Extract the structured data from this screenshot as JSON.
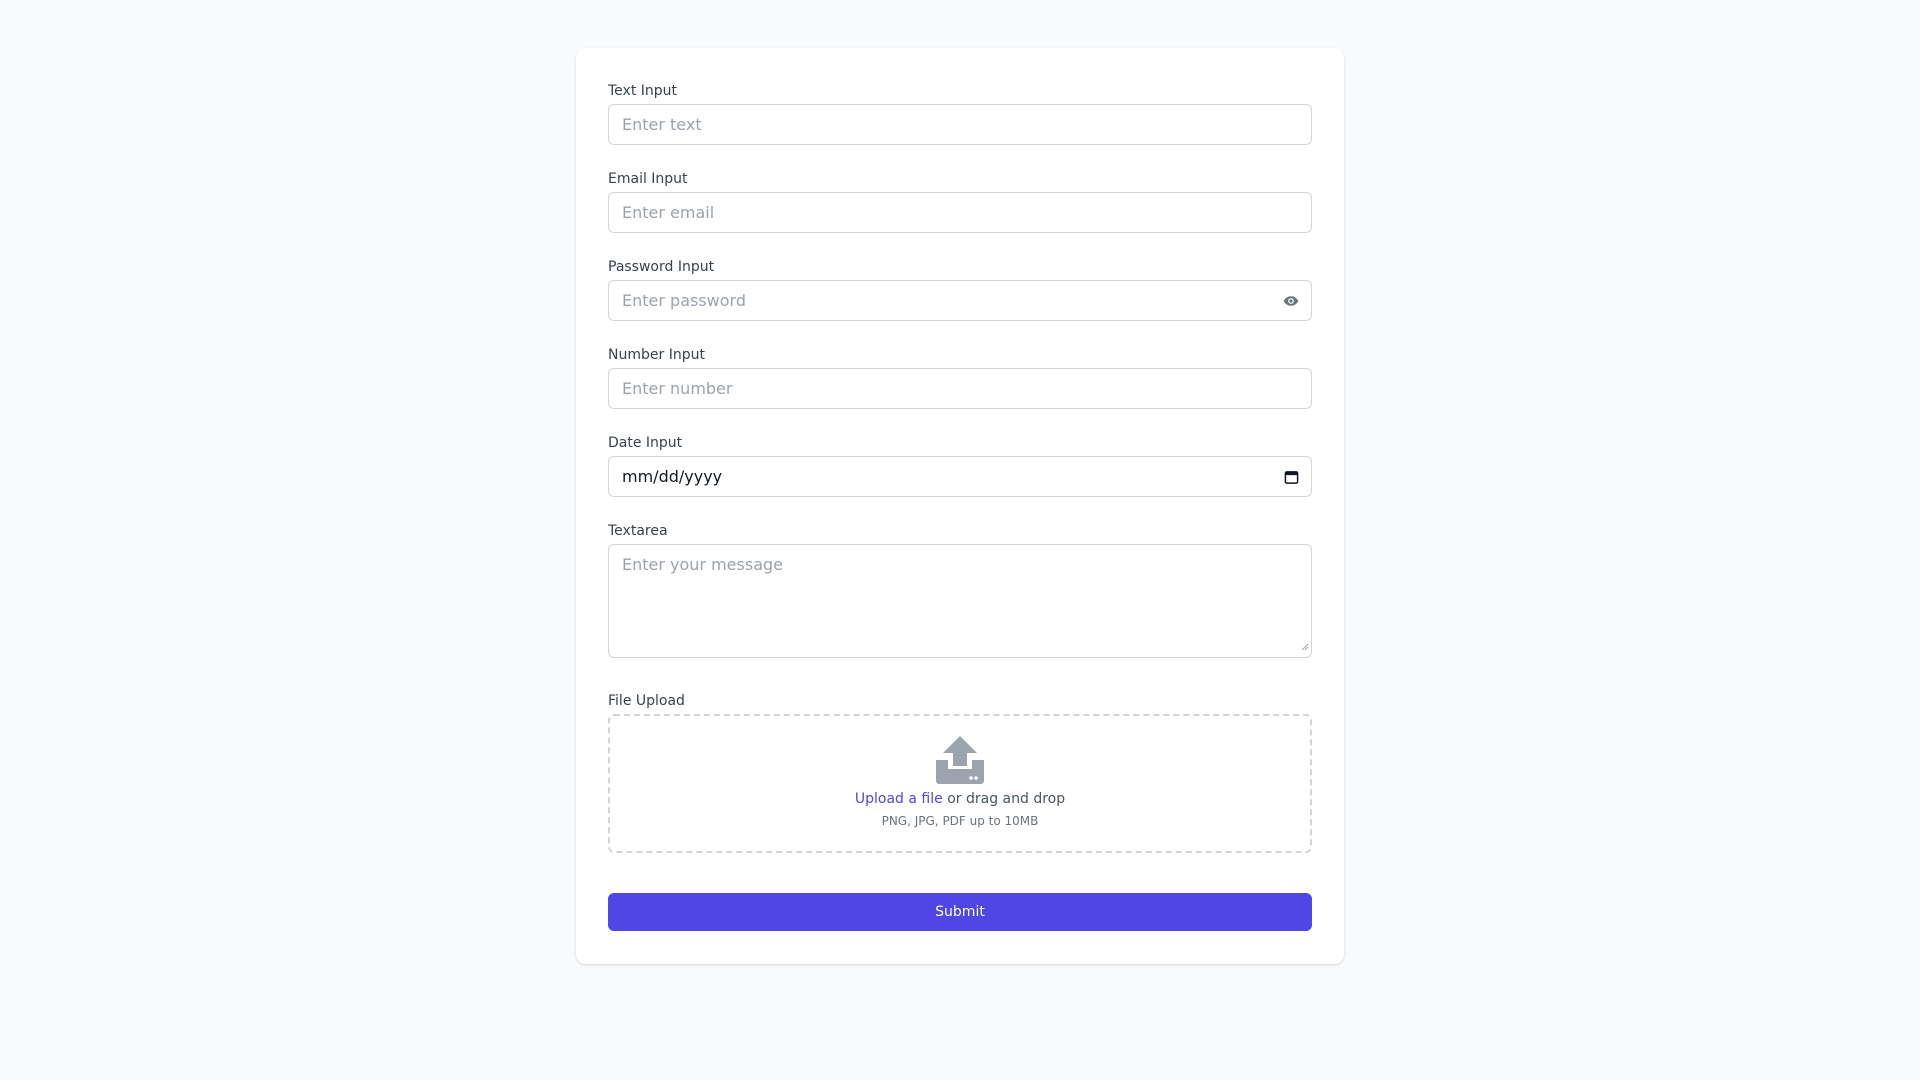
{
  "form": {
    "text_input": {
      "label": "Text Input",
      "placeholder": "Enter text"
    },
    "email_input": {
      "label": "Email Input",
      "placeholder": "Enter email"
    },
    "password_input": {
      "label": "Password Input",
      "placeholder": "Enter password",
      "toggle_icon": "eye-icon"
    },
    "number_input": {
      "label": "Number Input",
      "placeholder": "Enter number"
    },
    "date_input": {
      "label": "Date Input",
      "value": "mm/dd/yyyy",
      "picker_icon": "calendar-icon"
    },
    "textarea": {
      "label": "Textarea",
      "placeholder": "Enter your message"
    },
    "file_upload": {
      "label": "File Upload",
      "icon": "upload-icon",
      "link_text": "Upload a file",
      "drop_text": " or drag and drop",
      "hint": "PNG, JPG, PDF up to 10MB"
    },
    "submit_label": "Submit"
  },
  "colors": {
    "accent": "#4f46e5",
    "background": "#f9fafb",
    "border": "#d1d5db",
    "placeholder": "#9ca3af"
  }
}
